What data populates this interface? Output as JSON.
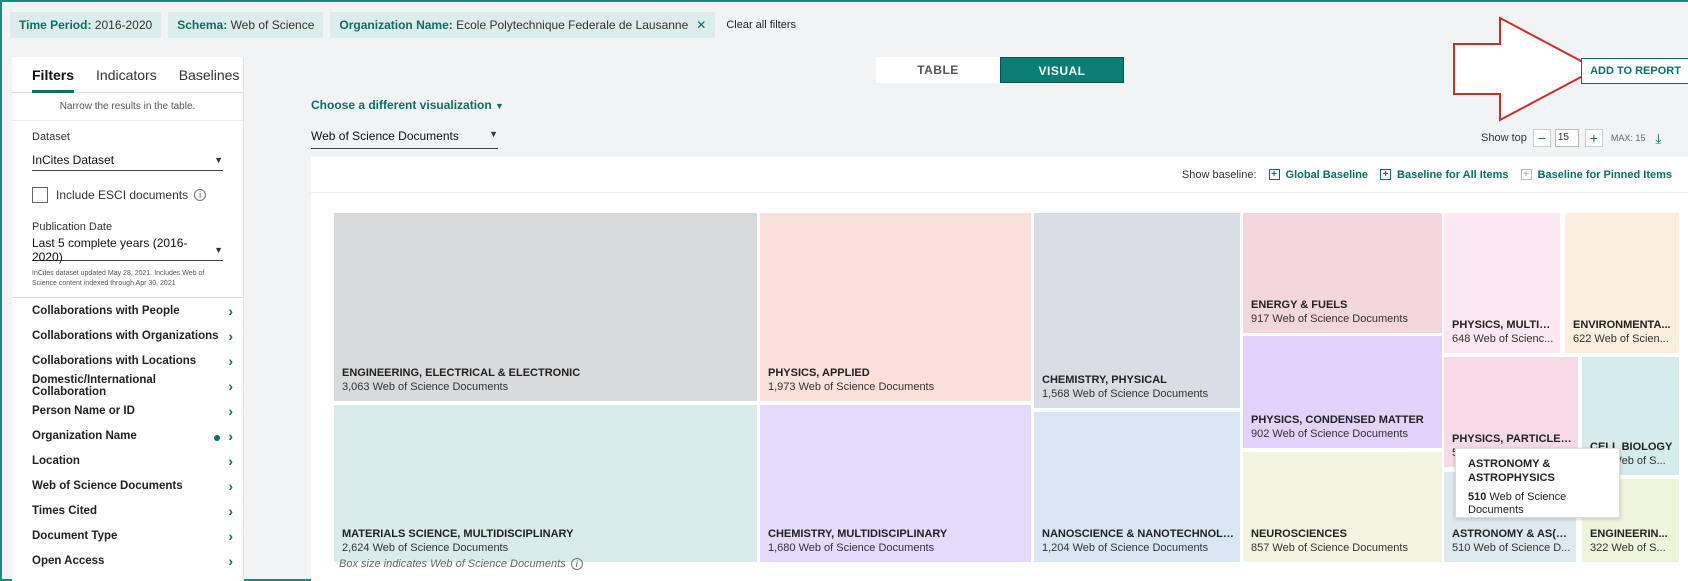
{
  "filters": [
    {
      "key": "Time Period:",
      "value": " 2016-2020",
      "removable": false
    },
    {
      "key": "Schema:",
      "value": " Web of Science",
      "removable": false
    },
    {
      "key": "Organization Name:",
      "value": " Ecole Polytechnique Federale de Lausanne",
      "removable": true
    }
  ],
  "clear_all": "Clear all filters",
  "sidebar": {
    "tabs": [
      "Filters",
      "Indicators",
      "Baselines"
    ],
    "narrow": "Narrow the results in the table.",
    "dataset_label": "Dataset",
    "dataset_value": "InCites Dataset",
    "esci_label": "Include ESCI documents",
    "pubdate_label": "Publication Date",
    "pubdate_value": "Last 5 complete years (2016-2020)",
    "note": "InCites dataset updated May 28, 2021. Includes Web of Science content indexed through Apr 30, 2021",
    "facets": [
      {
        "label": "Collaborations with People",
        "active": false
      },
      {
        "label": "Collaborations with Organizations",
        "active": false
      },
      {
        "label": "Collaborations with Locations",
        "active": false
      },
      {
        "label": "Domestic/International Collaboration",
        "active": false
      },
      {
        "label": "Person Name or ID",
        "active": false
      },
      {
        "label": "Organization Name",
        "active": true
      },
      {
        "label": "Location",
        "active": false
      },
      {
        "label": "Web of Science Documents",
        "active": false
      },
      {
        "label": "Times Cited",
        "active": false
      },
      {
        "label": "Document Type",
        "active": false
      },
      {
        "label": "Open Access",
        "active": false
      }
    ]
  },
  "view_toggle": {
    "table": "TABLE",
    "visual": "VISUAL",
    "selected": "visual"
  },
  "add_to_report": "ADD TO REPORT",
  "choose_viz": "Choose a different visualization",
  "metric_dropdown": "Web of Science Documents",
  "show_top": {
    "label": "Show top",
    "value": "15",
    "max": "MAX: 15"
  },
  "baseline": {
    "label": "Show baseline:",
    "options": [
      "Global Baseline",
      "Baseline for All Items",
      "Baseline for Pinned Items"
    ]
  },
  "box_note": "Box size indicates Web of Science Documents",
  "tooltip": {
    "name": "ASTRONOMY & ASTROPHYSICS",
    "count_num": "510",
    "count_text": " Web of Science Documents"
  },
  "colors": {
    "accent": "#0b6f68",
    "arrow": "#c8302a"
  },
  "treemap": [
    {
      "name": "ENGINEERING, ELECTRICAL & ELECTRONIC",
      "count": "3,063 Web of Science Documents",
      "color": "#d9dadc"
    },
    {
      "name": "MATERIALS SCIENCE, MULTIDISCIPLINARY",
      "count": "2,624 Web of Science Documents",
      "color": "#d9ebea"
    },
    {
      "name": "PHYSICS, APPLIED",
      "count": "1,973 Web of Science Documents",
      "color": "#fbe0dc"
    },
    {
      "name": "CHEMISTRY, MULTIDISCIPLINARY",
      "count": "1,680 Web of Science Documents",
      "color": "#e6dafd"
    },
    {
      "name": "CHEMISTRY, PHYSICAL",
      "count": "1,568 Web of Science Documents",
      "color": "#d9dde4"
    },
    {
      "name": "NANOSCIENCE & NANOTECHNOLOGY",
      "count": "1,204 Web of Science Documents",
      "color": "#d9e7f4"
    },
    {
      "name": "ENERGY & FUELS",
      "count": "917 Web of Science Documents",
      "color": "#f3d6de"
    },
    {
      "name": "PHYSICS, CONDENSED MATTER",
      "count": "902 Web of Science Documents",
      "color": "#e3d2fa"
    },
    {
      "name": "NEUROSCIENCES",
      "count": "857 Web of Science Documents",
      "color": "#f3f4e1"
    },
    {
      "name": "PHYSICS, MULTID...",
      "count": "648 Web of Scienc...",
      "color": "#fbe8f3"
    },
    {
      "name": "ENVIRONMENTA...",
      "count": "622 Web of Scien...",
      "color": "#fcefdf"
    },
    {
      "name": "PHYSICS, PARTICLES...",
      "count": "591 Web of Science D...",
      "color": "#f6dbe6"
    },
    {
      "name": "CELL BIOLOGY",
      "count": "488 Web of S...",
      "color": "#d6ecec"
    },
    {
      "name": "ASTRONOMY & AS(R...",
      "count": "510 Web of Science D...",
      "color": "#dfe9f0"
    },
    {
      "name": "ENGINEERIN...",
      "count": "322 Web of S...",
      "color": "#eff4dc"
    }
  ]
}
